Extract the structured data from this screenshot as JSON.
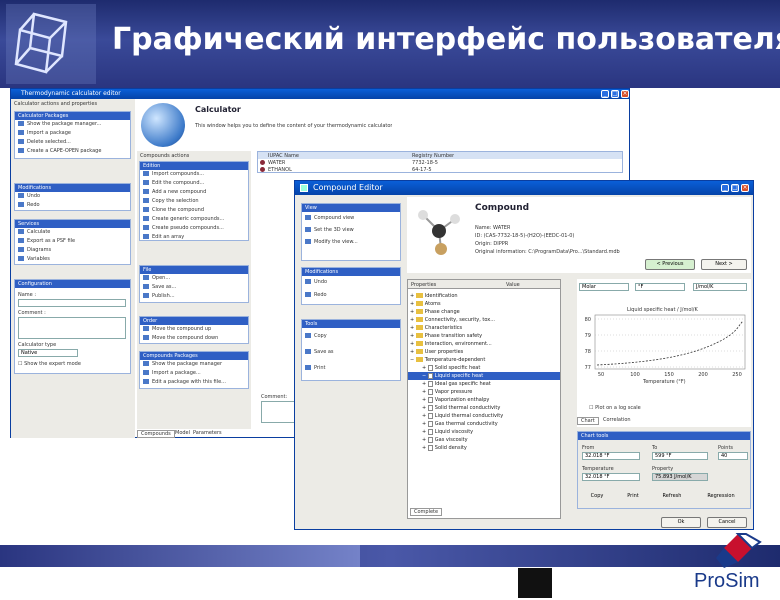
{
  "slide": {
    "title": "Графический интерфейс пользователя",
    "logo_text": "ProSim"
  },
  "main_window": {
    "title": "Thermodynamic calculator editor",
    "sidebar_caption": "Calculator actions and properties",
    "panels": [
      {
        "title": "Calculator Packages",
        "items": [
          "Show the package manager...",
          "Import a package",
          "Delete selected...",
          "Create a CAPE-OPEN package"
        ]
      },
      {
        "title": "Modifications",
        "items": [
          "Undo",
          "Redo"
        ]
      },
      {
        "title": "Services",
        "items": [
          "Calculate",
          "Export as a PSF file",
          "Diagrams",
          "Variables"
        ]
      },
      {
        "title": "Configuration",
        "items": [
          "Name :",
          "Comment :",
          "Calculator type",
          "Native",
          "Show the expert mode"
        ]
      }
    ],
    "calculator": {
      "title": "Calculator",
      "description": "This window helps you to define the content of your thermodynamic calculator"
    },
    "compounds_caption": "Compounds actions",
    "actions_panels": [
      {
        "title": "Edition",
        "items": [
          "Import compounds...",
          "Edit the compound...",
          "Add a new compound",
          "Copy the selection",
          "Clone the compound",
          "Create generic compounds...",
          "Create pseudo compounds...",
          "Edit an array"
        ]
      },
      {
        "title": "File",
        "items": [
          "Open...",
          "Save as...",
          "Publish..."
        ]
      },
      {
        "title": "Order",
        "items": [
          "Move the compound up",
          "Move the compound down"
        ]
      },
      {
        "title": "Compounds Packages",
        "items": [
          "Show the package manager",
          "Import a package...",
          "Edit a package with this file..."
        ]
      }
    ],
    "table": {
      "headers": [
        "IUPAC Name",
        "Registry Number"
      ],
      "rows": [
        [
          "WATER",
          "7732-18-5"
        ],
        [
          "ETHANOL",
          "64-17-5"
        ]
      ]
    },
    "comment_label": "Comment:",
    "bottom_tabs": [
      "Compounds",
      "Model",
      "Parameters"
    ]
  },
  "compound_editor": {
    "title": "Compound Editor",
    "left_panels": [
      {
        "title": "View",
        "items": [
          "Compound view",
          "Set the 3D view",
          "Modify the view..."
        ]
      },
      {
        "title": "Modifications",
        "items": [
          "Undo",
          "Redo"
        ]
      },
      {
        "title": "Tools",
        "items": [
          "Copy",
          "Save as",
          "Print"
        ]
      }
    ],
    "compound": {
      "title": "Compound",
      "name": "Name: WATER",
      "id": "ID: (CAS-7732-18-5)-(H2O)-(EEDC-01-0)",
      "origin": "Origin: DIPPR",
      "original_info": "Original information: C:\\ProgramData\\Pro...\\Standard.mdb",
      "previous_label": "< Previous",
      "next_label": "Next >"
    },
    "tree": {
      "col_properties": "Properties",
      "col_value": "Value",
      "rows": [
        {
          "label": "Identification",
          "type": "folder",
          "expand": "+"
        },
        {
          "label": "Atoms",
          "type": "folder",
          "expand": "+"
        },
        {
          "label": "Phase change",
          "type": "folder",
          "expand": "+"
        },
        {
          "label": "Connectivity, security, tox...",
          "type": "folder",
          "expand": "+"
        },
        {
          "label": "Characteristics",
          "type": "folder",
          "expand": "+"
        },
        {
          "label": "Phase transition safety",
          "type": "folder",
          "expand": "+"
        },
        {
          "label": "Interaction, environment...",
          "type": "folder",
          "expand": "+"
        },
        {
          "label": "User properties",
          "type": "folder",
          "expand": "+"
        },
        {
          "label": "Temperature-dependent",
          "type": "folder",
          "expand": "−"
        },
        {
          "label": "Solid specific heat",
          "type": "doc",
          "expand": "+"
        },
        {
          "label": "Liquid specific heat",
          "type": "doc",
          "expand": "−",
          "selected": true
        },
        {
          "label": "Ideal gas specific heat",
          "type": "doc",
          "expand": "+"
        },
        {
          "label": "Vapor pressure",
          "type": "doc",
          "expand": "+"
        },
        {
          "label": "Vaporization enthalpy",
          "type": "doc",
          "expand": "+"
        },
        {
          "label": "Solid thermal conductivity",
          "type": "doc",
          "expand": "+"
        },
        {
          "label": "Liquid thermal conductivity",
          "type": "doc",
          "expand": "+"
        },
        {
          "label": "Gas thermal conductivity",
          "type": "doc",
          "expand": "+"
        },
        {
          "label": "Liquid viscosity",
          "type": "doc",
          "expand": "+"
        },
        {
          "label": "Gas viscosity",
          "type": "doc",
          "expand": "+"
        },
        {
          "label": "Solid density",
          "type": "doc",
          "expand": "+"
        }
      ],
      "bottom_tab": "Complete"
    },
    "plot": {
      "unit_basis": "Molar",
      "unit_temp": "°F",
      "unit_energy": "J/mol/K",
      "title": "Liquid specific heat / J/mol/K",
      "xlabel": "Temperature (°F)",
      "xticks": [
        "50",
        "100",
        "150",
        "200",
        "250"
      ],
      "yticks": [
        "80",
        "79",
        "78",
        "77"
      ],
      "opt_plot": "Plot on a log scale",
      "tabs": [
        "Chart",
        "Correlation"
      ]
    },
    "chart_tools": {
      "title": "Chart tools",
      "from_label": "From",
      "from_value": "32.018 °F",
      "to_label": "To",
      "to_value": "599 °F",
      "points_label": "Points",
      "points_value": "40",
      "temperature_label": "Temperature",
      "temperature_value": "32.018 °F",
      "property_label": "Property",
      "property_value": "75.893 J/mol/K",
      "copy": "Copy",
      "print": "Print",
      "refresh": "Refresh",
      "regression": "Regression"
    },
    "ok": "Ok",
    "cancel": "Cancel"
  },
  "colors": {
    "banner": "#2a3580",
    "titlebar": "#0a5fd8",
    "panel_header": "#2f5fc4",
    "footer": "#1e2b6e"
  }
}
